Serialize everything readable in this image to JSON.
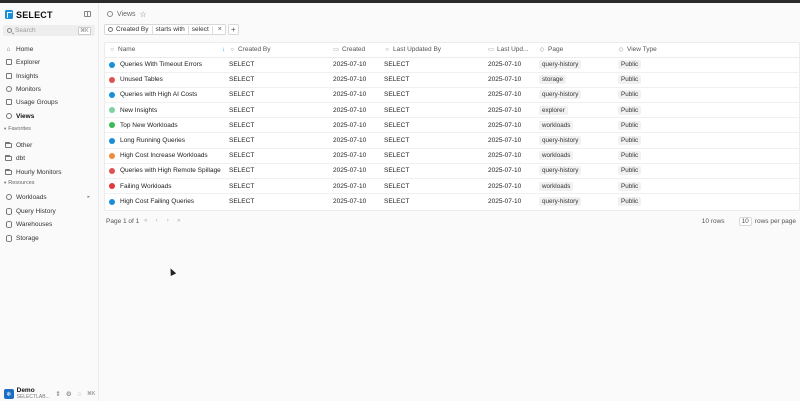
{
  "brand": {
    "name": "SELECT"
  },
  "search": {
    "placeholder": "Search",
    "shortcut": "⌘K"
  },
  "nav": {
    "home": "Home",
    "explorer": "Explorer",
    "insights": "Insights",
    "monitors": "Monitors",
    "usage_groups": "Usage Groups",
    "views": "Views"
  },
  "favorites": {
    "label": "Favorites",
    "items": [
      "Other",
      "dbt",
      "Hourly Monitors"
    ]
  },
  "resources": {
    "label": "Resources",
    "items": [
      "Workloads",
      "Query History",
      "Warehouses",
      "Storage"
    ]
  },
  "footer": {
    "org_name": "Demo",
    "org_sub": "SELECTLAB...",
    "shortcut": "⌘K"
  },
  "breadcrumb": {
    "title": "Views"
  },
  "filter": {
    "field": "Created By",
    "operator": "starts with",
    "value": "select",
    "add_label": "+"
  },
  "table": {
    "columns": [
      "Name",
      "Created By",
      "Created",
      "Last Updated By",
      "Last Upd...",
      "Page",
      "View Type"
    ],
    "rows": [
      {
        "name": "Queries With Timeout Errors",
        "created_by": "SELECT",
        "created": "2025-07-10",
        "updated_by": "SELECT",
        "updated": "2025-07-10",
        "page": "query-history",
        "type": "Public",
        "icon_color": "#1a8fd9"
      },
      {
        "name": "Unused Tables",
        "created_by": "SELECT",
        "created": "2025-07-10",
        "updated_by": "SELECT",
        "updated": "2025-07-10",
        "page": "storage",
        "type": "Public",
        "icon_color": "#e05252"
      },
      {
        "name": "Queries with High AI Costs",
        "created_by": "SELECT",
        "created": "2025-07-10",
        "updated_by": "SELECT",
        "updated": "2025-07-10",
        "page": "query-history",
        "type": "Public",
        "icon_color": "#1a8fd9"
      },
      {
        "name": "New Insights",
        "created_by": "SELECT",
        "created": "2025-07-10",
        "updated_by": "SELECT",
        "updated": "2025-07-10",
        "page": "explorer",
        "type": "Public",
        "icon_color": "#7fd1a0"
      },
      {
        "name": "Top New Workloads",
        "created_by": "SELECT",
        "created": "2025-07-10",
        "updated_by": "SELECT",
        "updated": "2025-07-10",
        "page": "workloads",
        "type": "Public",
        "icon_color": "#3cba54"
      },
      {
        "name": "Long Running Queries",
        "created_by": "SELECT",
        "created": "2025-07-10",
        "updated_by": "SELECT",
        "updated": "2025-07-10",
        "page": "query-history",
        "type": "Public",
        "icon_color": "#1a8fd9"
      },
      {
        "name": "High Cost Increase Workloads",
        "created_by": "SELECT",
        "created": "2025-07-10",
        "updated_by": "SELECT",
        "updated": "2025-07-10",
        "page": "workloads",
        "type": "Public",
        "icon_color": "#f08a3c"
      },
      {
        "name": "Queries with High Remote Spillage",
        "created_by": "SELECT",
        "created": "2025-07-10",
        "updated_by": "SELECT",
        "updated": "2025-07-10",
        "page": "query-history",
        "type": "Public",
        "icon_color": "#e05252"
      },
      {
        "name": "Failing Workloads",
        "created_by": "SELECT",
        "created": "2025-07-10",
        "updated_by": "SELECT",
        "updated": "2025-07-10",
        "page": "workloads",
        "type": "Public",
        "icon_color": "#e03a3a"
      },
      {
        "name": "High Cost Failing Queries",
        "created_by": "SELECT",
        "created": "2025-07-10",
        "updated_by": "SELECT",
        "updated": "2025-07-10",
        "page": "query-history",
        "type": "Public",
        "icon_color": "#1a8fd9"
      }
    ]
  },
  "pager": {
    "page_label": "Page 1 of 1",
    "rows_count": "10 rows",
    "rows_per_page_value": "10",
    "rows_per_page_label": "rows per page"
  }
}
